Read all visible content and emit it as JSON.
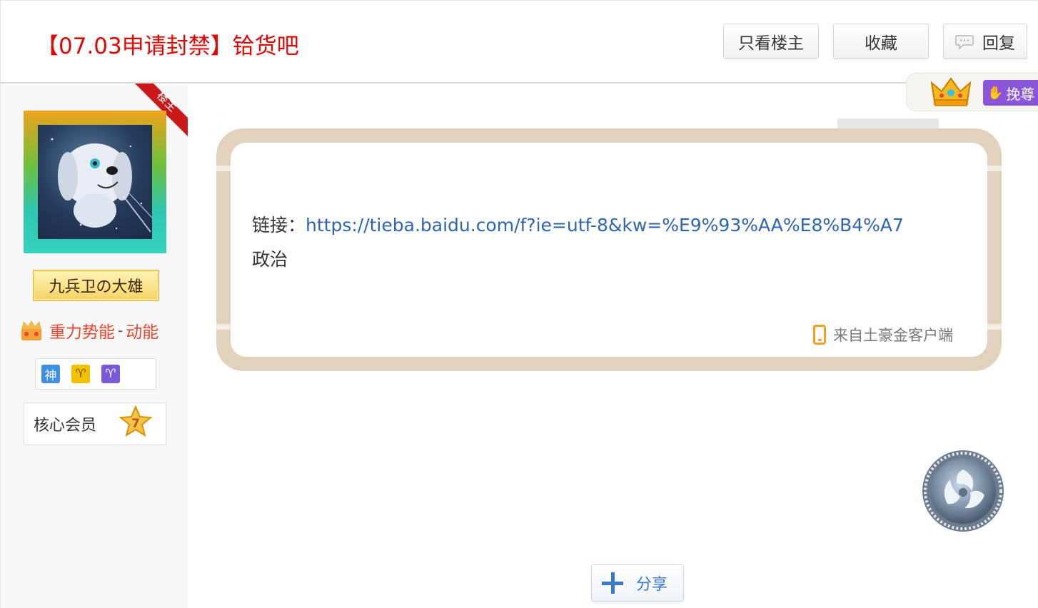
{
  "thread": {
    "title": "【07.03申请封禁】铪货吧"
  },
  "header_buttons": {
    "only_op": "只看楼主",
    "favorite": "收藏",
    "reply": "回复"
  },
  "crown_badge": {
    "text": "挽尊"
  },
  "author": {
    "op_ribbon": "楼主",
    "username": "九兵卫の大雄",
    "level_title_1": "重力势能",
    "level_separator": "-",
    "level_title_2": "动能",
    "mini_badges": [
      "神",
      "♈",
      "♈"
    ],
    "membership": "核心会员",
    "membership_level": "7"
  },
  "post": {
    "link_label": "链接：",
    "link_url": "https://tieba.baidu.com/f?ie=utf-8&kw=%E9%93%AA%E8%B4%A7",
    "line2": "政治",
    "client_source": "来自土豪金客户端"
  },
  "share": {
    "label": "分享"
  },
  "colors": {
    "title_red": "#e10602",
    "link_blue": "#2d64b3",
    "bubble_border": "#e2d2bb",
    "level_red": "#e8452c",
    "share_blue": "#3a78c9"
  }
}
